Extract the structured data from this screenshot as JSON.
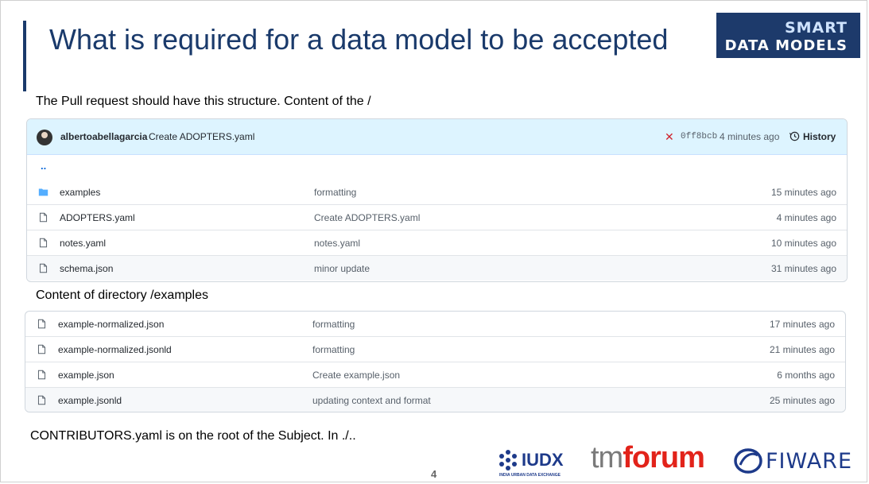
{
  "slide": {
    "title": "What is required for a data model to be accepted",
    "logo_line1": "SMART",
    "logo_line2": "DATA MODELS",
    "intro": "The Pull request should have this structure. Content of the /",
    "examples_heading": "Content of directory /examples",
    "footer": "CONTRIBUTORS.yaml is on the root of the Subject. In ./..",
    "page_number": "4"
  },
  "root_panel": {
    "commit_author": "albertoabellagarcia",
    "commit_message": "Create ADOPTERS.yaml",
    "status_icon": "x-icon",
    "sha": "0ff8bcb",
    "time": "4 minutes ago",
    "history_label": "History",
    "parent_link": "..",
    "rows": [
      {
        "type": "folder",
        "name": "examples",
        "message": "formatting",
        "age": "15 minutes ago"
      },
      {
        "type": "file",
        "name": "ADOPTERS.yaml",
        "message": "Create ADOPTERS.yaml",
        "age": "4 minutes ago"
      },
      {
        "type": "file",
        "name": "notes.yaml",
        "message": "notes.yaml",
        "age": "10 minutes ago"
      },
      {
        "type": "file",
        "name": "schema.json",
        "message": "minor update",
        "age": "31 minutes ago"
      }
    ]
  },
  "examples_panel": {
    "rows": [
      {
        "type": "file",
        "name": "example-normalized.json",
        "message": "formatting",
        "age": "17 minutes ago"
      },
      {
        "type": "file",
        "name": "example-normalized.jsonld",
        "message": "formatting",
        "age": "21 minutes ago"
      },
      {
        "type": "file",
        "name": "example.json",
        "message": "Create example.json",
        "age": "6 months ago"
      },
      {
        "type": "file",
        "name": "example.jsonld",
        "message": "updating context and format",
        "age": "25 minutes ago"
      }
    ]
  },
  "logos": {
    "iudx_word": "IUDX",
    "iudx_tagline": "INDIA URBAN DATA EXCHANGE",
    "tm_part": "tm",
    "forum_part": "forum",
    "fiware_word": "FIWARE"
  },
  "colors": {
    "title": "#1a3a6b",
    "header_bg": "#ddf4ff",
    "link": "#0969da",
    "error": "#cf222e",
    "tmforum_red": "#e2231a"
  }
}
